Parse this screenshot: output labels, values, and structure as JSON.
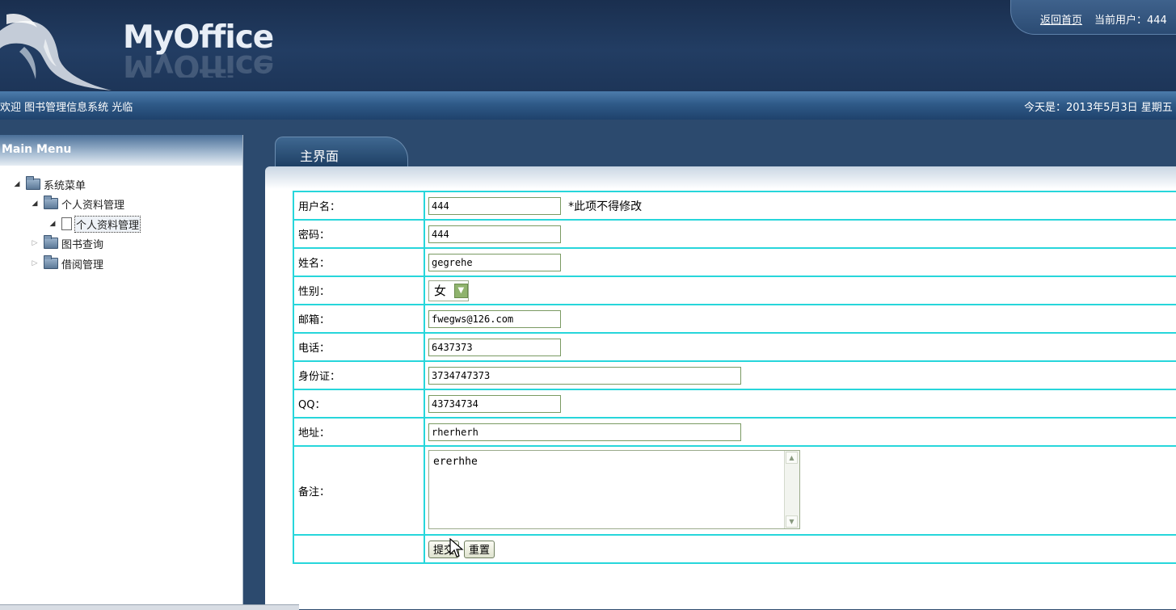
{
  "header": {
    "logo": "MyOffice",
    "home_link": "返回首页",
    "current_user": "当前用户：444"
  },
  "welcome_bar": {
    "welcome": "欢迎 图书管理信息系统 光临",
    "date": "今天是：2013年5月3日 星期五"
  },
  "menu": {
    "title": "Main Menu",
    "tree": {
      "root": "系统菜单",
      "personal": "个人资料管理",
      "personal_child": "个人资料管理",
      "book_query": "图书查询",
      "borrow": "借阅管理"
    }
  },
  "main": {
    "tab": "主界面"
  },
  "form": {
    "labels": {
      "username": "用户名：",
      "password": "密码：",
      "name": "姓名：",
      "gender": "性别：",
      "email": "邮箱：",
      "phone": "电话：",
      "idcard": "身份证：",
      "qq": "QQ：",
      "address": "地址：",
      "remark": "备注："
    },
    "values": {
      "username": "444",
      "password": "444",
      "name": "gegrehe",
      "gender": "女",
      "email": "fwegws@126.com",
      "phone": "6437373",
      "idcard": "3734747373",
      "qq": "43734734",
      "address": "rherherh",
      "remark": "ererhhe"
    },
    "username_note": "*此项不得修改",
    "submit": "提交",
    "reset": "重置"
  }
}
